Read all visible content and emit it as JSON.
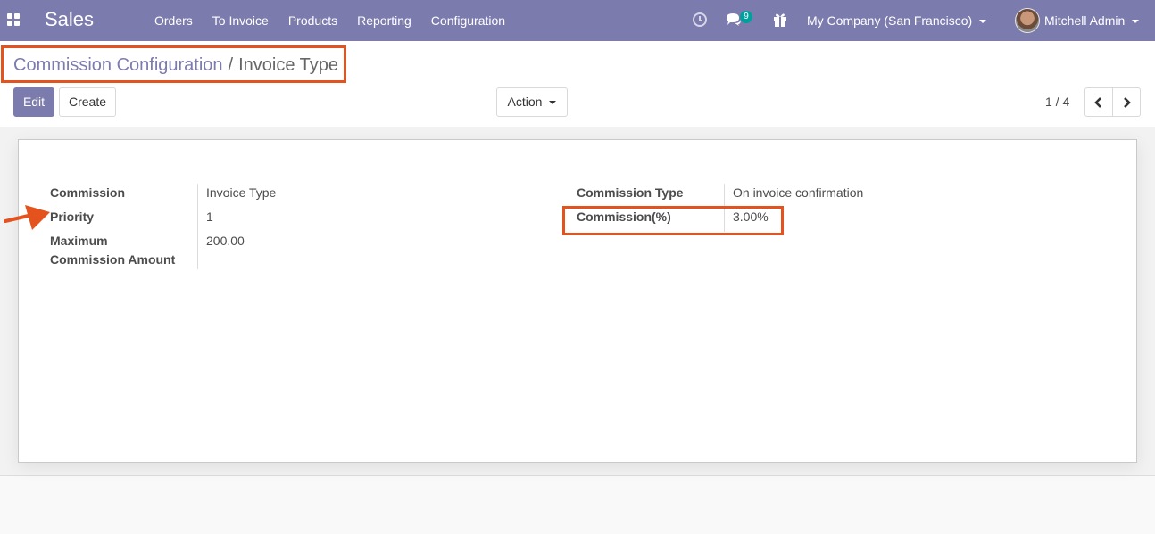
{
  "navbar": {
    "app_name": "Sales",
    "menu": [
      "Orders",
      "To Invoice",
      "Products",
      "Reporting",
      "Configuration"
    ],
    "chat_badge": "9",
    "company": "My Company (San Francisco)",
    "user": "Mitchell Admin",
    "icons": [
      "apps-icon",
      "clock-icon",
      "chat-icon",
      "gift-icon",
      "avatar"
    ]
  },
  "breadcrumb": {
    "parent": "Commission Configuration",
    "separator": "/",
    "current": "Invoice Type"
  },
  "toolbar": {
    "edit": "Edit",
    "create": "Create",
    "action": "Action"
  },
  "pager": {
    "value": "1 / 4"
  },
  "form": {
    "left": [
      {
        "label": "Commission",
        "value": "Invoice Type"
      },
      {
        "label": "Priority",
        "value": "1"
      },
      {
        "label_line1": "Maximum",
        "label_line2": "Commission Amount",
        "value": "200.00"
      }
    ],
    "right": [
      {
        "label": "Commission Type",
        "value": "On invoice confirmation"
      },
      {
        "label": "Commission(%)",
        "value": "3.00%"
      }
    ]
  },
  "colors": {
    "brand": "#7c7bad",
    "highlight": "#e4531e"
  }
}
